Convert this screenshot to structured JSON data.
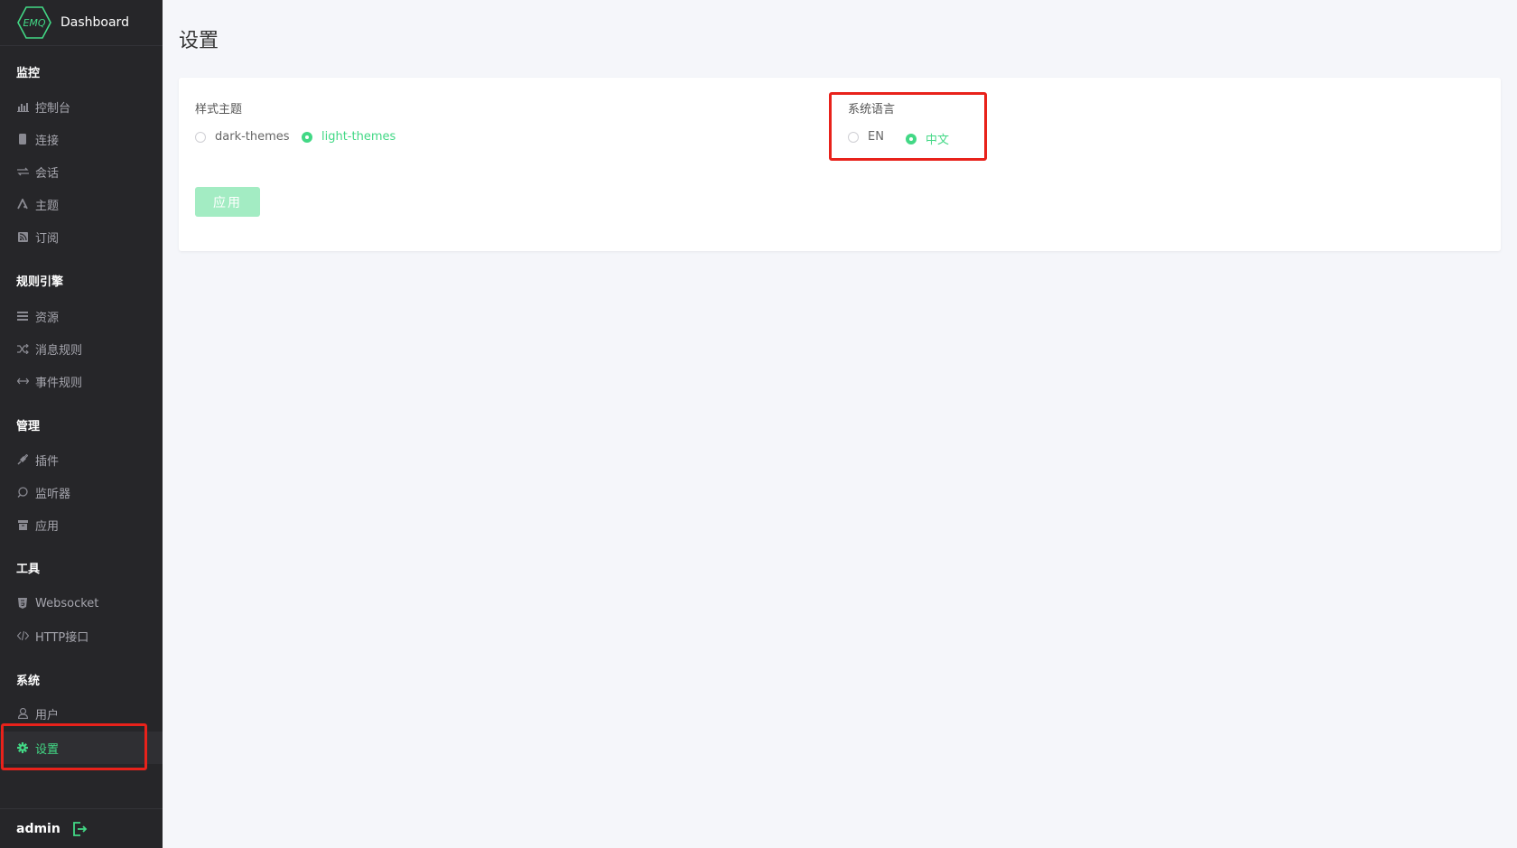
{
  "app": {
    "logo_text": "EMQ",
    "title": "Dashboard"
  },
  "sidebar": {
    "groups": [
      {
        "title": "监控",
        "items": [
          {
            "label": "控制台",
            "icon": "bar-chart-icon"
          },
          {
            "label": "连接",
            "icon": "device-icon"
          },
          {
            "label": "会话",
            "icon": "swap-icon"
          },
          {
            "label": "主题",
            "icon": "topic-icon"
          },
          {
            "label": "订阅",
            "icon": "rss-icon"
          }
        ]
      },
      {
        "title": "规则引擎",
        "items": [
          {
            "label": "资源",
            "icon": "list-icon"
          },
          {
            "label": "消息规则",
            "icon": "shuffle-icon"
          },
          {
            "label": "事件规则",
            "icon": "arrows-icon"
          }
        ]
      },
      {
        "title": "管理",
        "items": [
          {
            "label": "插件",
            "icon": "plug-icon"
          },
          {
            "label": "监听器",
            "icon": "chat-icon"
          },
          {
            "label": "应用",
            "icon": "box-icon"
          }
        ]
      },
      {
        "title": "工具",
        "items": [
          {
            "label": "Websocket",
            "icon": "html5-icon"
          },
          {
            "label": "HTTP接口",
            "icon": "code-icon"
          }
        ]
      },
      {
        "title": "系统",
        "items": [
          {
            "label": "用户",
            "icon": "user-icon"
          },
          {
            "label": "设置",
            "icon": "gear-icon",
            "active": true
          }
        ]
      }
    ],
    "user": "admin"
  },
  "main": {
    "title": "设置",
    "theme": {
      "label": "样式主题",
      "options": [
        "dark-themes",
        "light-themes"
      ],
      "selected": "light-themes"
    },
    "language": {
      "label": "系统语言",
      "options": [
        "EN",
        "中文"
      ],
      "selected": "中文"
    },
    "apply_label": "应用"
  },
  "colors": {
    "accent": "#42d885",
    "sidebar_bg": "#262629",
    "highlight": "#e8221b",
    "page_bg": "#f5f6fa"
  }
}
